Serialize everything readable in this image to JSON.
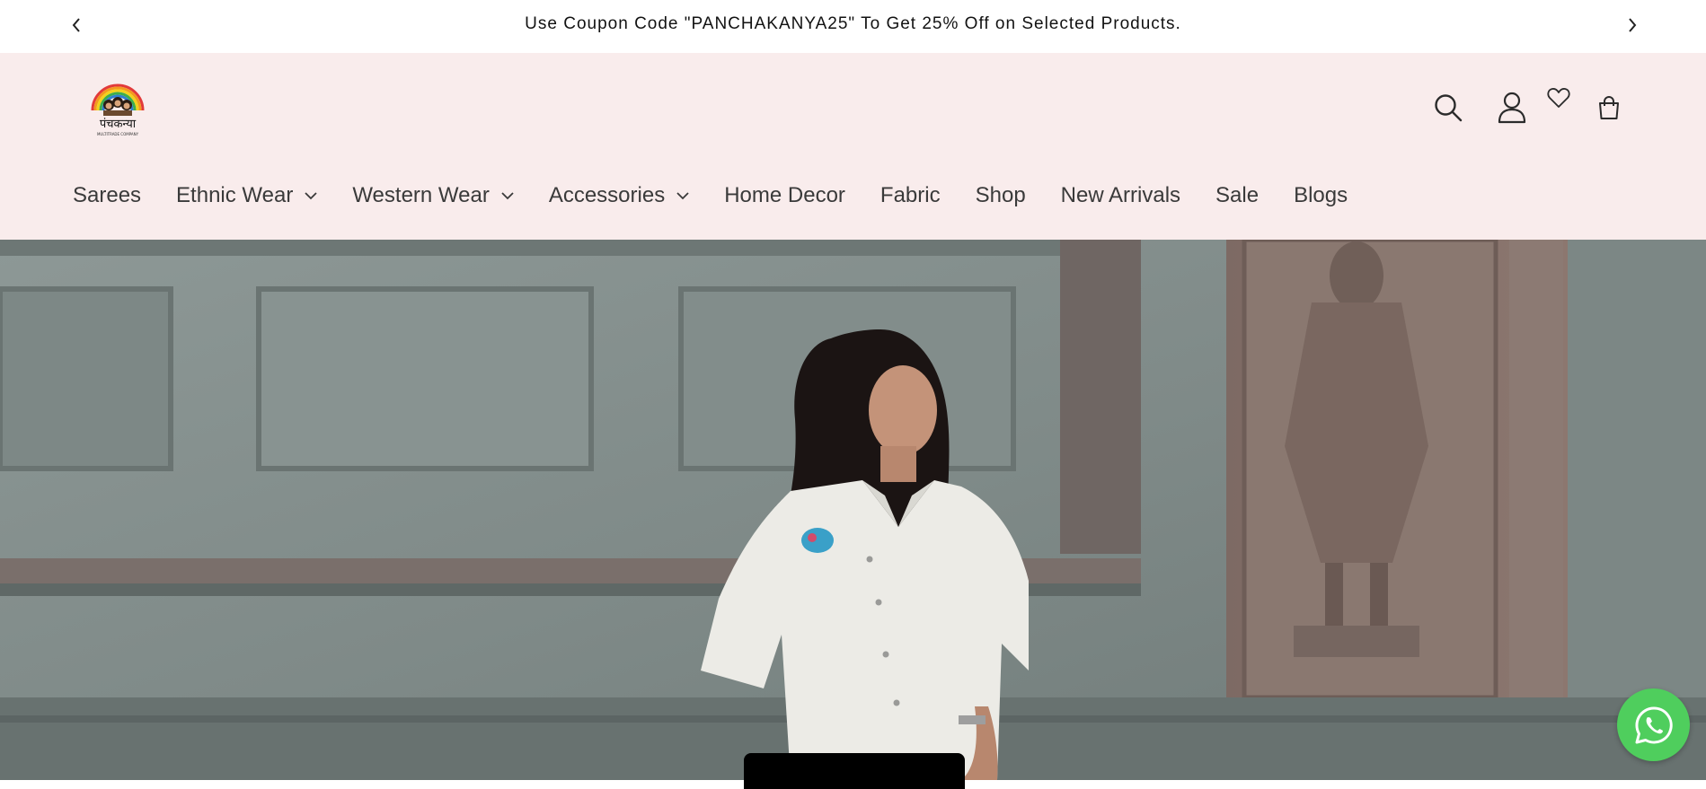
{
  "announcement": {
    "text": "Use Coupon Code \"PANCHAKANYA25\" To Get 25% Off on Selected Products.",
    "prev_icon": "chevron-left-icon",
    "next_icon": "chevron-right-icon"
  },
  "header": {
    "logo_text": "पंचकन्या",
    "logo_subtext": "MULTITRADE COMPANY",
    "icons": [
      "search-icon",
      "account-icon",
      "heart-icon",
      "cart-icon"
    ]
  },
  "nav": {
    "items": [
      {
        "label": "Sarees",
        "has_dropdown": false
      },
      {
        "label": "Ethnic Wear",
        "has_dropdown": true
      },
      {
        "label": "Western Wear",
        "has_dropdown": true
      },
      {
        "label": "Accessories",
        "has_dropdown": true
      },
      {
        "label": "Home Decor",
        "has_dropdown": false
      },
      {
        "label": "Fabric",
        "has_dropdown": false
      },
      {
        "label": "Shop",
        "has_dropdown": false
      },
      {
        "label": "New Arrivals",
        "has_dropdown": false
      },
      {
        "label": "Sale",
        "has_dropdown": false
      },
      {
        "label": "Blogs",
        "has_dropdown": false
      }
    ]
  },
  "hero": {
    "image": "woman-in-white-shirt-before-carved-stone-wall",
    "button_label": ""
  },
  "colors": {
    "header_bg": "#f9ecec",
    "announcement_bg": "#ffffff",
    "whatsapp": "#4fce5d",
    "text": "#3a3a3a"
  },
  "floating": {
    "whatsapp_icon": "whatsapp-icon"
  }
}
